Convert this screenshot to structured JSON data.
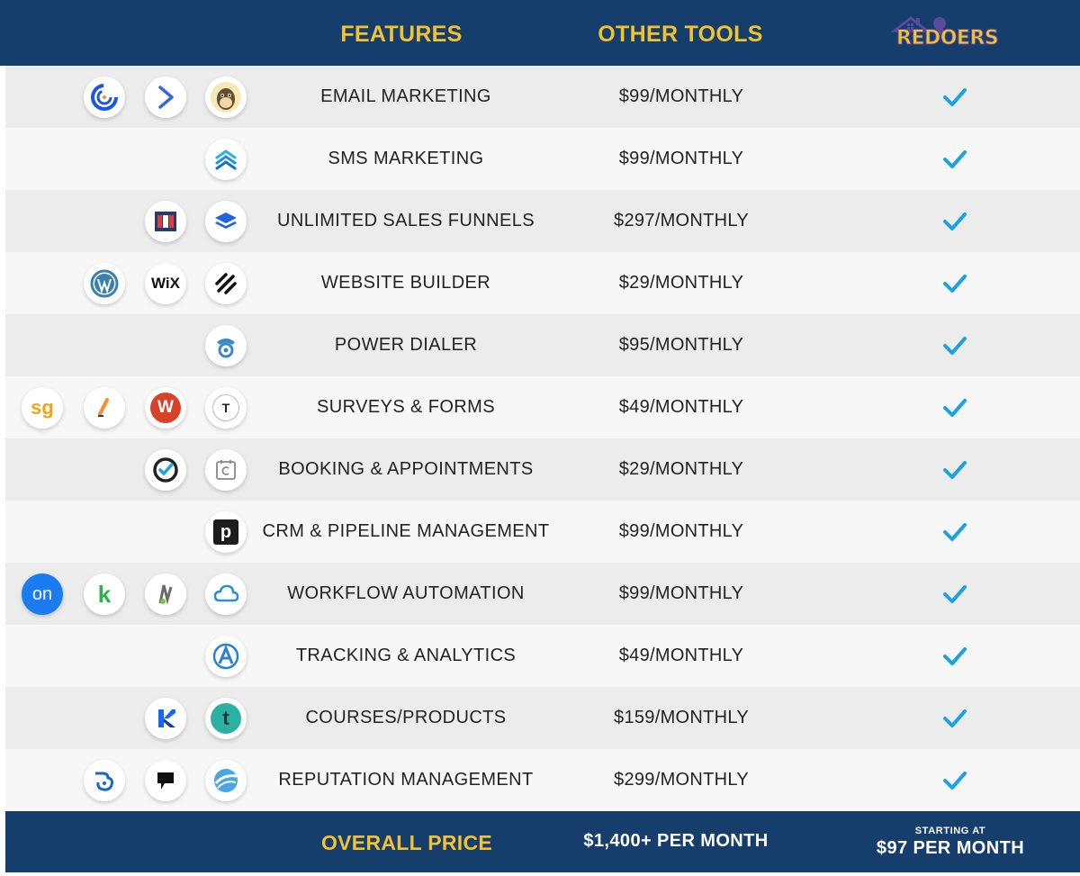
{
  "header": {
    "features": "FEATURES",
    "other_tools": "OTHER TOOLS",
    "brand_re": "RE",
    "brand_doers": "DOERS"
  },
  "colors": {
    "navy": "#163e6c",
    "gold": "#f2c230",
    "check": "#1aa3e0"
  },
  "rows": [
    {
      "feature": "EMAIL MARKETING",
      "price": "$99/MONTHLY",
      "icons": [
        "mailchimp-icon",
        "activecampaign-icon",
        "constant-contact-icon"
      ]
    },
    {
      "feature": "SMS MARKETING",
      "price": "$99/MONTHLY",
      "icons": [
        "sms-stack-icon"
      ]
    },
    {
      "feature": "UNLIMITED SALES FUNNELS",
      "price": "$297/MONTHLY",
      "icons": [
        "layers-icon",
        "clickfunnels-icon"
      ]
    },
    {
      "feature": "WEBSITE BUILDER",
      "price": "$29/MONTHLY",
      "icons": [
        "squarespace-icon",
        "wix-icon",
        "wordpress-icon"
      ]
    },
    {
      "feature": "POWER DIALER",
      "price": "$95/MONTHLY",
      "icons": [
        "dialer-icon"
      ]
    },
    {
      "feature": "SURVEYS & FORMS",
      "price": "$49/MONTHLY",
      "icons": [
        "typeform-icon",
        "wufoo-icon",
        "jotform-icon",
        "surveygizmo-icon"
      ]
    },
    {
      "feature": "BOOKING & APPOINTMENTS",
      "price": "$29/MONTHLY",
      "icons": [
        "calendly-icon",
        "acuity-icon"
      ]
    },
    {
      "feature": "CRM & PIPELINE MANAGEMENT",
      "price": "$99/MONTHLY",
      "icons": [
        "pipedrive-icon"
      ]
    },
    {
      "feature": "WORKFLOW AUTOMATION",
      "price": "$99/MONTHLY",
      "icons": [
        "cloud-icon",
        "integromat-icon",
        "keap-icon",
        "ontraport-icon"
      ]
    },
    {
      "feature": "TRACKING & ANALYTICS",
      "price": "$49/MONTHLY",
      "icons": [
        "analytics-icon"
      ]
    },
    {
      "feature": "COURSES/PRODUCTS",
      "price": "$159/MONTHLY",
      "icons": [
        "teachable-icon",
        "kajabi-icon"
      ]
    },
    {
      "feature": "REPUTATION MANAGEMENT",
      "price": "$299/MONTHLY",
      "icons": [
        "birdeye-icon",
        "podium-icon",
        "reputation-icon"
      ]
    }
  ],
  "icon_text": {
    "wix": "WiX",
    "surveygizmo": "sg",
    "typeform": "T",
    "pipedrive": "p",
    "ontraport": "on",
    "keap": "k",
    "teachable": "t",
    "wufoo": "W"
  },
  "footer": {
    "label": "OVERALL PRICE",
    "other_total": "$1,400+ PER MONTH",
    "starting_small": "STARTING AT",
    "starting_big": "$97 PER MONTH"
  }
}
